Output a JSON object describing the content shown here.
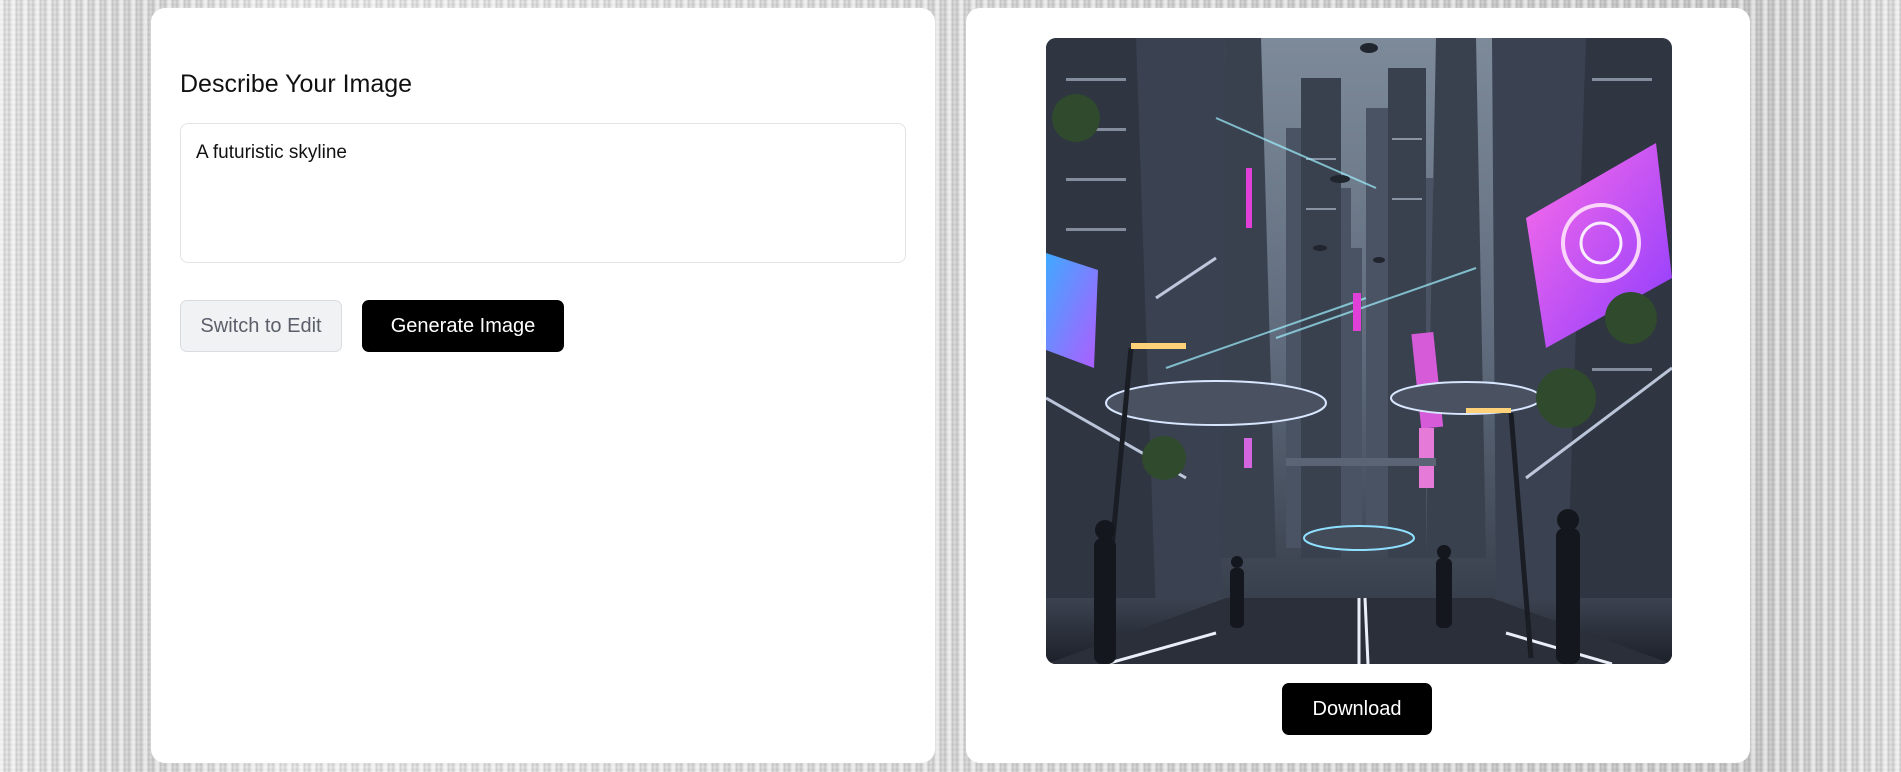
{
  "generator": {
    "heading": "Describe Your Image",
    "prompt_value": "A futuristic skyline",
    "switch_button_label": "Switch to Edit",
    "generate_button_label": "Generate Image"
  },
  "output": {
    "image_alt": "futuristic city skyline with neon billboards and flying vehicles",
    "download_button_label": "Download"
  },
  "colors": {
    "primary_button": "#000000",
    "secondary_button": "#f1f2f4",
    "neon_magenta": "#e040d8",
    "neon_cyan": "#4fd6ff"
  }
}
